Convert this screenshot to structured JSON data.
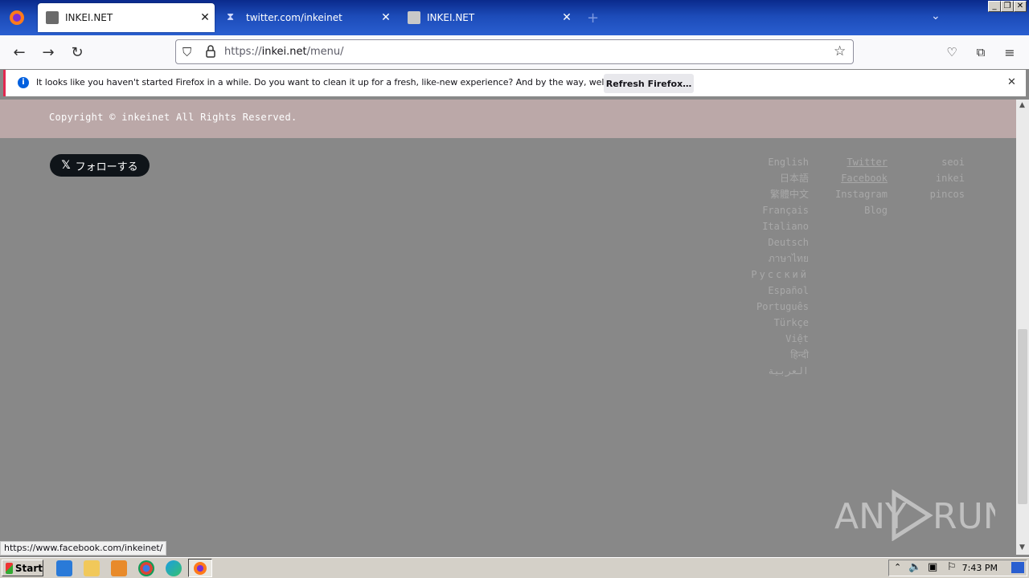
{
  "browser": {
    "tabs": [
      {
        "title": "INKEI.NET",
        "active": true
      },
      {
        "title": "twitter.com/inkeinet",
        "active": false
      },
      {
        "title": "INKEI.NET",
        "active": false
      }
    ],
    "new_tab_glyph": "+",
    "url_scheme": "https://",
    "url_host": "inkei.net",
    "url_path": "/menu/"
  },
  "notification": {
    "message": "It looks like you haven't started Firefox in a while. Do you want to clean it up for a fresh, like-new experience? And by the way, welcome back!",
    "button": "Refresh Firefox…"
  },
  "page": {
    "copyright": "Copyright © inkeinet All Rights Reserved.",
    "follow_button": "フォローする",
    "languages": [
      "English",
      "日本語",
      "繁體中文",
      "Français",
      "Italiano",
      "Deutsch",
      "ภาษาไทย",
      "Русский",
      "Español",
      "Português",
      "Türkçe",
      "Việt",
      "हिन्दी",
      "العربية"
    ],
    "social": [
      "Twitter",
      "Facebook",
      "Instagram",
      "Blog"
    ],
    "people": [
      "seoi",
      "inkei",
      "pincos"
    ]
  },
  "status_url": "https://www.facebook.com/inkeinet/",
  "watermark": "ANY RUN",
  "taskbar": {
    "start": "Start",
    "clock": "7:43 PM"
  },
  "colors": {
    "page_bg": "#888888",
    "copyright_band": "#bba8a8",
    "link_text": "#a8a8a8",
    "tabbar": "#1c4bb8"
  }
}
